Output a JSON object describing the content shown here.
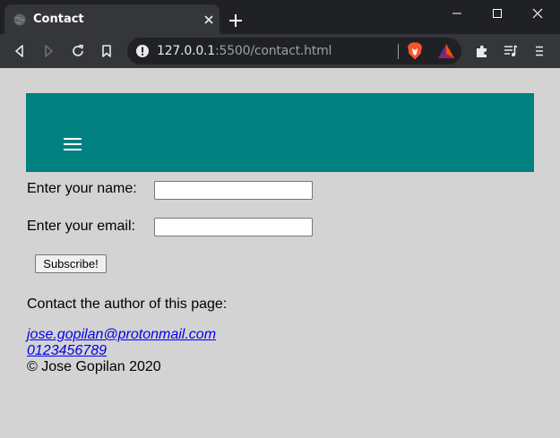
{
  "tab": {
    "title": "Contact"
  },
  "address_bar": {
    "host": "127.0.0.1",
    "rest": ":5500/contact.html"
  },
  "form": {
    "name_label": "Enter your name:",
    "name_value": "",
    "email_label": "Enter your email:",
    "email_value": "",
    "subscribe_label": "Subscribe!"
  },
  "contact": {
    "heading": "Contact the author of this page:",
    "email_link": "jose.gopilan@protonmail.com",
    "phone_link": "0123456789",
    "copyright": "© Jose Gopilan 2020"
  },
  "colors": {
    "header_band": "#008080",
    "page_bg": "#d3d3d3",
    "browser_chrome": "#202124"
  }
}
